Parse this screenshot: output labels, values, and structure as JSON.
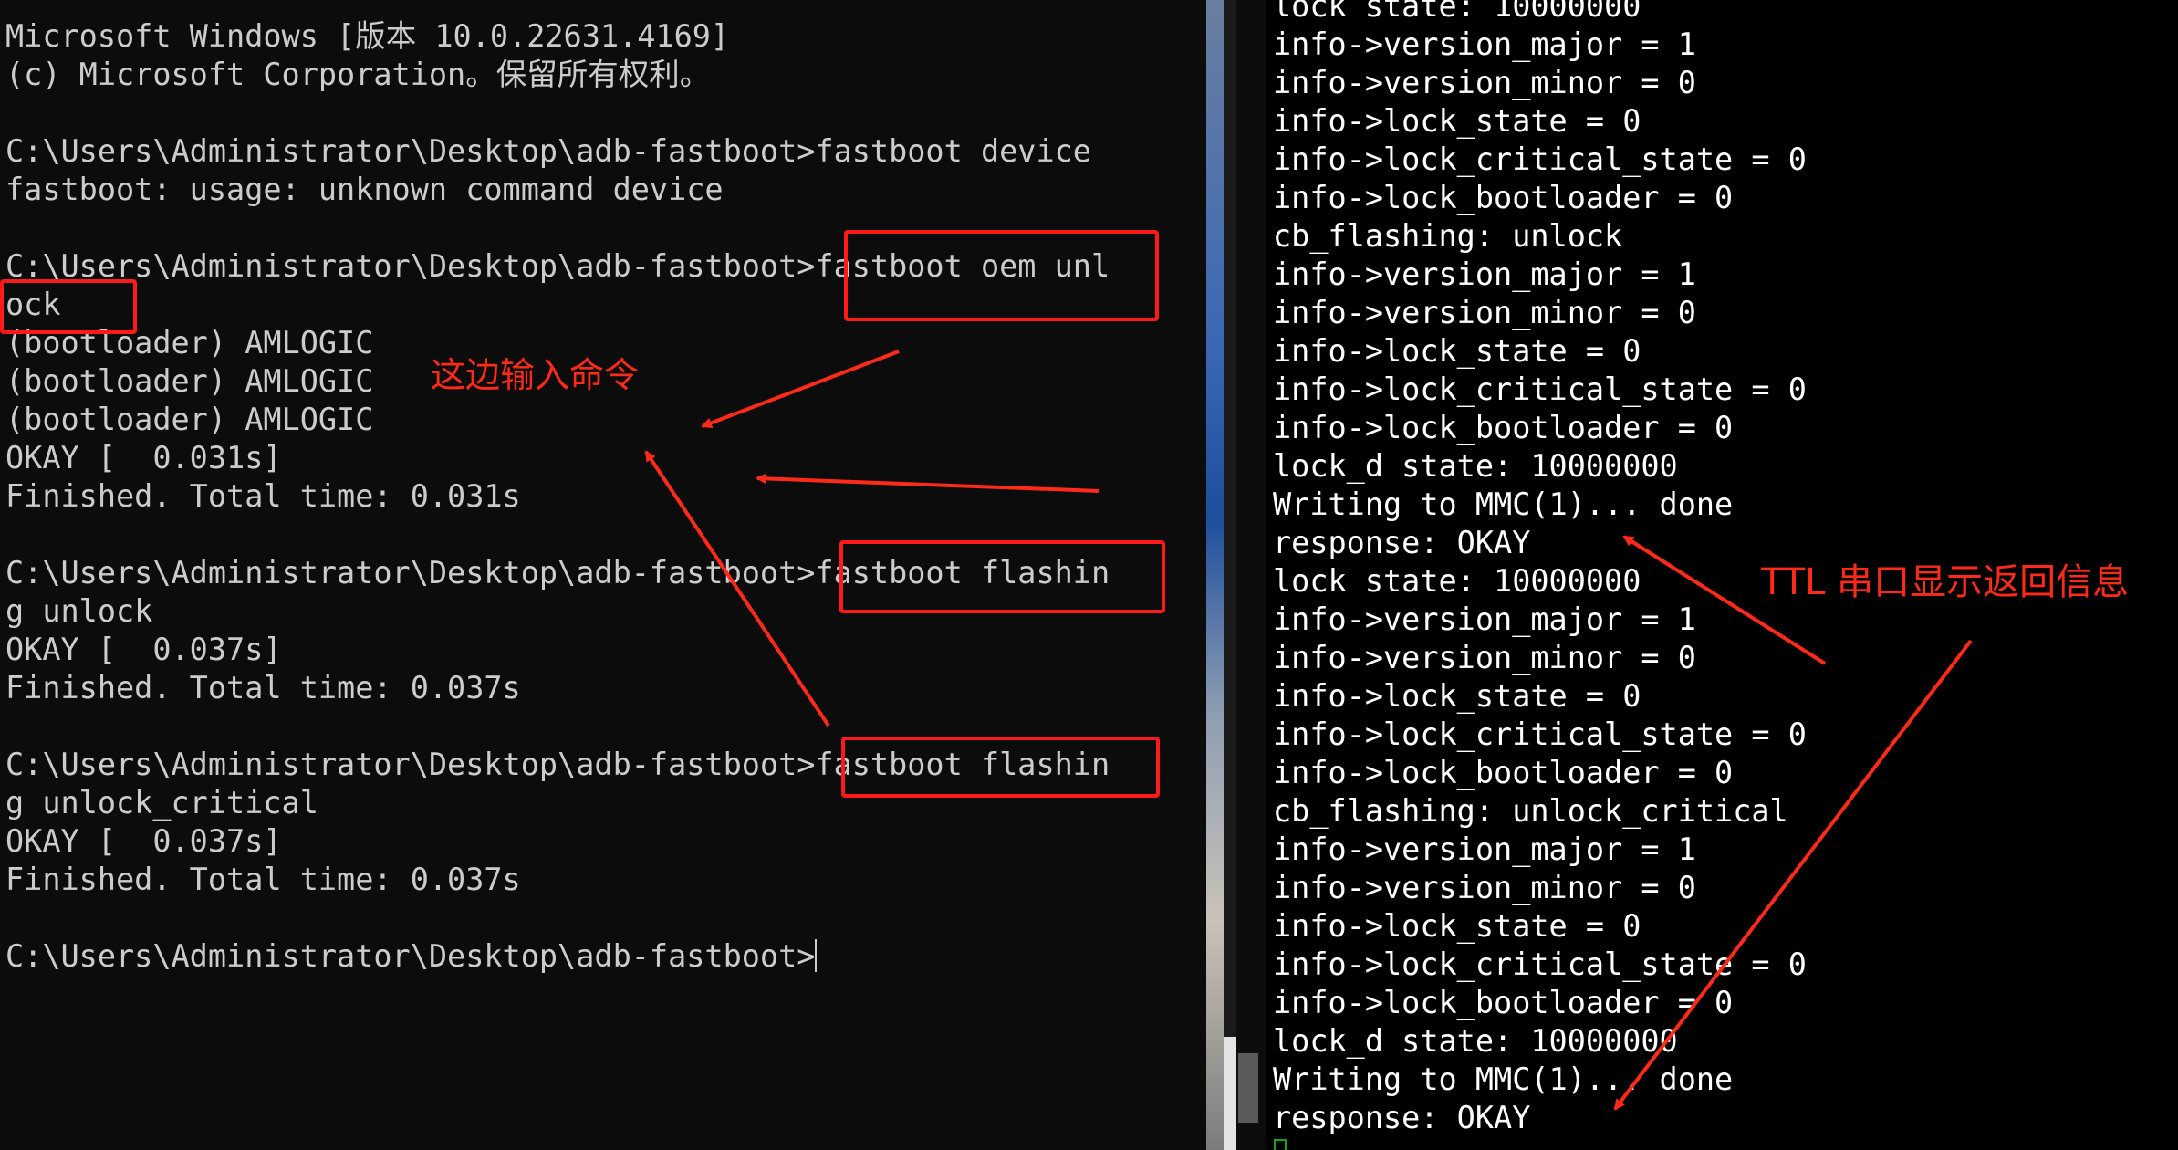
{
  "left_terminal": {
    "lines": [
      "Microsoft Windows [版本 10.0.22631.4169]",
      "(c) Microsoft Corporation。保留所有权利。",
      "",
      "C:\\Users\\Administrator\\Desktop\\adb-fastboot>fastboot device",
      "fastboot: usage: unknown command device",
      "",
      "C:\\Users\\Administrator\\Desktop\\adb-fastboot>fastboot oem unl",
      "ock",
      "(bootloader) AMLOGIC",
      "(bootloader) AMLOGIC",
      "(bootloader) AMLOGIC",
      "OKAY [  0.031s]",
      "Finished. Total time: 0.031s",
      "",
      "C:\\Users\\Administrator\\Desktop\\adb-fastboot>fastboot flashin",
      "g unlock",
      "OKAY [  0.037s]",
      "Finished. Total time: 0.037s",
      "",
      "C:\\Users\\Administrator\\Desktop\\adb-fastboot>fastboot flashin",
      "g unlock_critical",
      "OKAY [  0.037s]",
      "Finished. Total time: 0.037s",
      "",
      "C:\\Users\\Administrator\\Desktop\\adb-fastboot>"
    ]
  },
  "right_terminal": {
    "lines": [
      "lock state: 10000000",
      "info->version_major = 1",
      "info->version_minor = 0",
      "info->lock_state = 0",
      "info->lock_critical_state = 0",
      "info->lock_bootloader = 0",
      "cb_flashing: unlock",
      "info->version_major = 1",
      "info->version_minor = 0",
      "info->lock_state = 0",
      "info->lock_critical_state = 0",
      "info->lock_bootloader = 0",
      "lock_d state: 10000000",
      "Writing to MMC(1)... done",
      "response: OKAY",
      "lock state: 10000000",
      "info->version_major = 1",
      "info->version_minor = 0",
      "info->lock_state = 0",
      "info->lock_critical_state = 0",
      "info->lock_bootloader = 0",
      "cb_flashing: unlock_critical",
      "info->version_major = 1",
      "info->version_minor = 0",
      "info->lock_state = 0",
      "info->lock_critical_state = 0",
      "info->lock_bootloader = 0",
      "lock_d state: 10000000",
      "Writing to MMC(1)... done",
      "response: OKAY"
    ]
  },
  "annotations": {
    "input_label": "这边输入命令",
    "ttl_label": "TTL 串口显示返回信息",
    "color": "#ff2a1a"
  },
  "colors": {
    "left_background": "#0c0c0c",
    "left_text": "#cccccc",
    "right_background": "#000000",
    "right_text": "#ffffff",
    "cursor_green": "#1aa31a"
  }
}
